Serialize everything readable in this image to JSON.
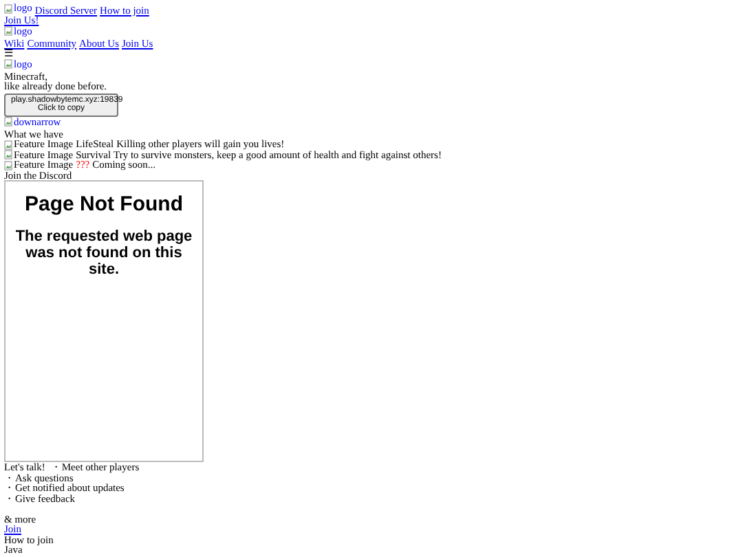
{
  "top_bar": {
    "logo_alt": "logo",
    "links": [
      "Discord Server",
      "How to join"
    ],
    "join_link": "Join Us!"
  },
  "nav": {
    "logo_alt": "logo",
    "links": [
      "Wiki",
      "Community",
      "About Us",
      "Join Us"
    ],
    "menu_glyph": "☰"
  },
  "hero": {
    "logo_alt": "logo",
    "lines": [
      "Minecraft,",
      "like already done before."
    ],
    "copy_button": {
      "address": "play.shadowbytemc.xyz:19839",
      "action": "Click to copy"
    },
    "arrow_alt": "downarrow"
  },
  "features": {
    "heading": "What we have",
    "items": [
      {
        "image_alt": "Feature Image",
        "title": "LifeSteal",
        "color": "#000000",
        "text": "Killing other players will gain you lives!"
      },
      {
        "image_alt": "Feature Image",
        "title": "Survival",
        "color": "#000000",
        "text": "Try to survive monsters, keep a good amount of health and fight against others!"
      },
      {
        "image_alt": "Feature Image",
        "title": "???",
        "color": "#ff0000",
        "text": "Coming soon..."
      }
    ]
  },
  "discord": {
    "heading": "Join the Discord",
    "embed": {
      "title": "Page Not Found",
      "message": "The requested web page was not found on this site."
    },
    "talk": "Let's talk!",
    "bullets": [
      "・Meet other players",
      "・Ask questions",
      "・Get notified about updates",
      "・Give feedback"
    ],
    "more": "& more",
    "join_link": "Join"
  },
  "how_to_join": {
    "heading": "How to join",
    "edition": "Java"
  }
}
